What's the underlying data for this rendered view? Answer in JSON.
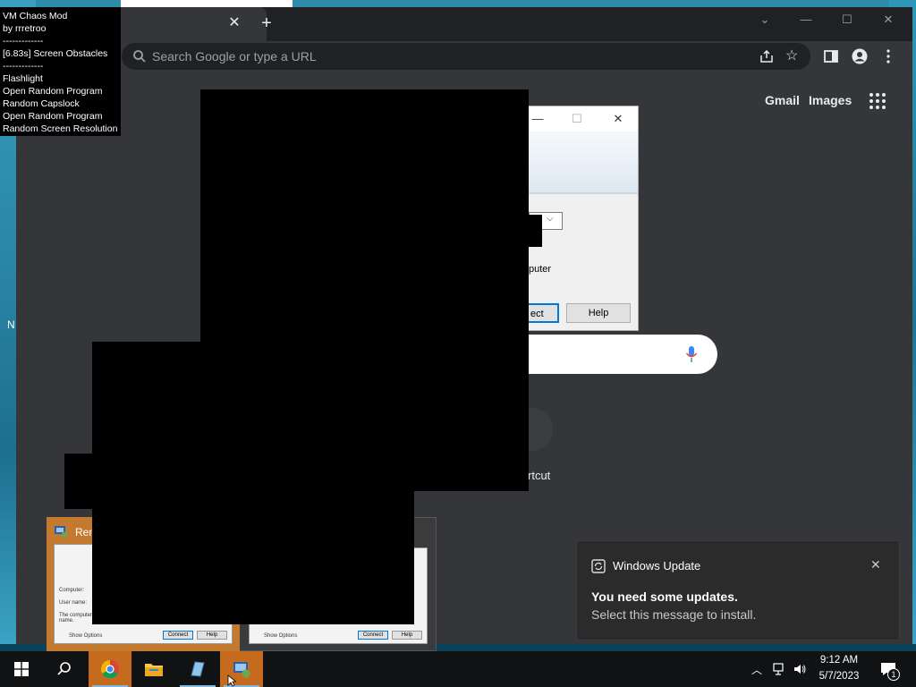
{
  "chaos_mod": {
    "lines": [
      "VM Chaos Mod",
      "by rrretroo",
      "-------------",
      "[6.83s] Screen Obstacles",
      "-------------",
      "Flashlight",
      "Open Random Program",
      "Random Capslock",
      "Open Random Program",
      "Random Screen Resolution"
    ]
  },
  "chrome": {
    "omnibox_placeholder": "Search Google or type a URL",
    "links": {
      "gmail": "Gmail",
      "images": "Images"
    },
    "shortcut_label": "rtcut"
  },
  "rdp_dialog": {
    "text_fragment": "puter",
    "connect_label": "ect",
    "help_label": "Help"
  },
  "thumbnails": {
    "title_fragment": "Ren",
    "card_connect": "Connect",
    "card_help": "Help",
    "card_options": "Show Options",
    "card_computer": "Computer:",
    "card_username": "User name:",
    "card_desc": "The computer n... name."
  },
  "desktop": {
    "icon_label_fragment": "N"
  },
  "toast": {
    "app": "Windows Update",
    "title": "You need some updates.",
    "body": "Select this message to install."
  },
  "taskbar": {
    "time": "9:12 AM",
    "date": "5/7/2023",
    "notification_count": "1"
  },
  "colors": {
    "accent": "#0078d7",
    "active_taskbar": "#c66a1e"
  }
}
